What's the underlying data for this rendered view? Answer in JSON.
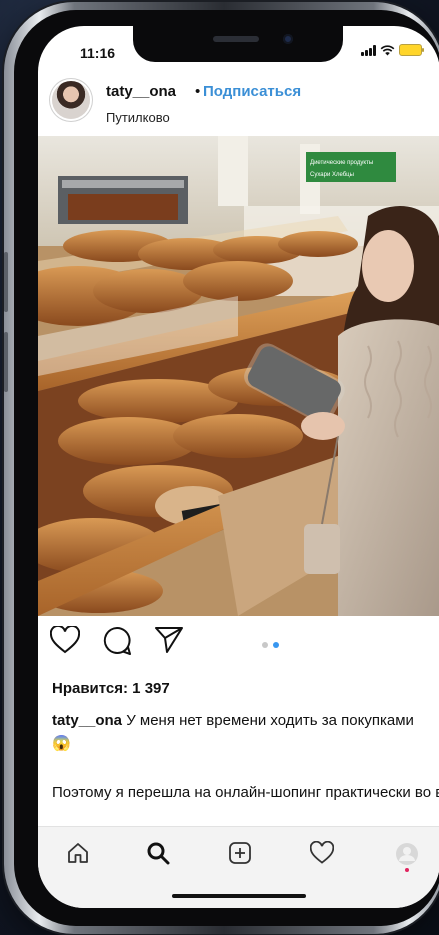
{
  "status_bar": {
    "time": "11:16"
  },
  "post": {
    "username": "taty__ona",
    "separator": "•",
    "follow_label": "Подписаться",
    "location": "Путилково",
    "store_sign": "Диетические продукты\nСухари  Хлебцы",
    "carousel": {
      "count": 2,
      "active_index": 1
    },
    "likes_text": "Нравится: 1 397",
    "caption_user": "taty__ona",
    "caption_text": "У меня нет времени ходить за покупками😱",
    "caption_more": "Поэтому я перешла на онлайн-шопинг практически во всем. Сначала это были кни"
  },
  "icons": {
    "like": "heart-icon",
    "comment": "comment-icon",
    "share": "send-icon",
    "home": "home-icon",
    "search": "search-icon",
    "new_post": "add-post-icon",
    "activity": "heart-outline-icon",
    "profile": "profile-icon"
  },
  "colors": {
    "accent": "#3b8fd6",
    "carousel_active": "#3897f0",
    "tabbar_bg": "#f3f3f3"
  }
}
